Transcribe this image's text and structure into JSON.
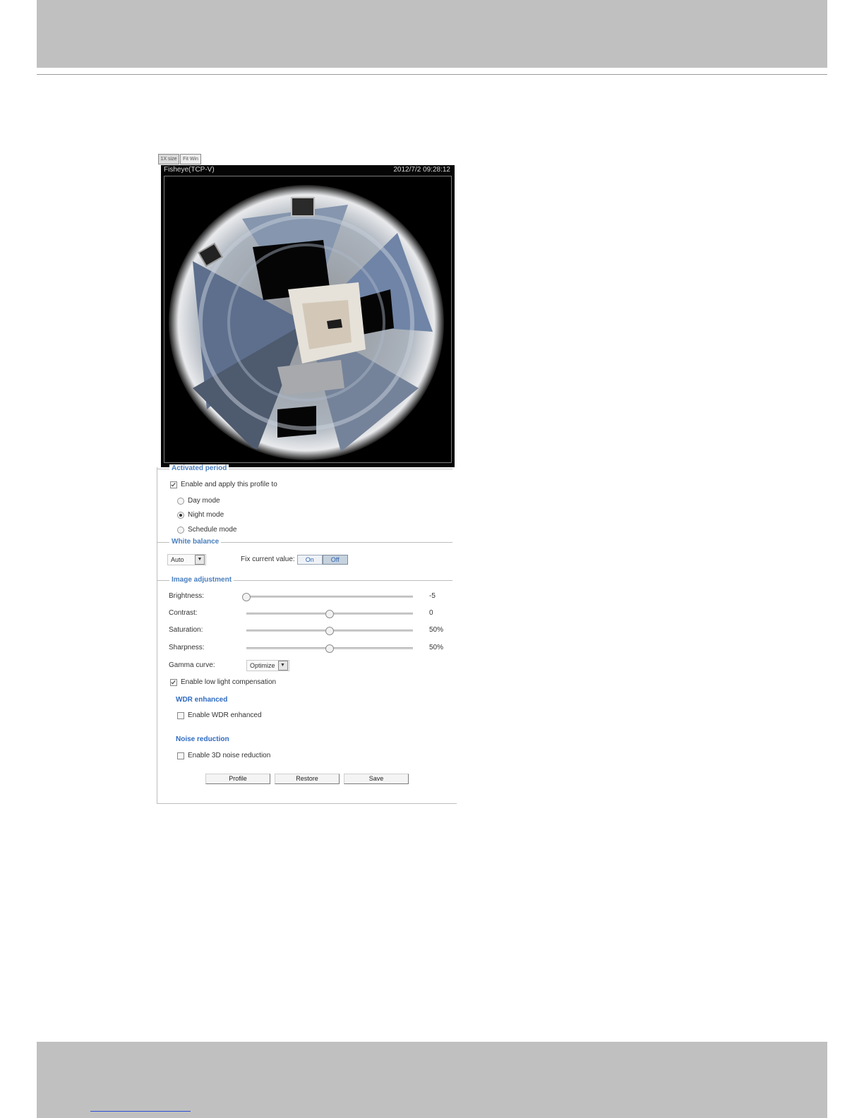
{
  "view_tabs": [
    "1X size",
    "Fit Win"
  ],
  "video": {
    "title": "Fisheye(TCP-V)",
    "timestamp": "2012/7/2 09:28:12"
  },
  "activated_period": {
    "legend": "Activated period",
    "enable_label": "Enable and apply this profile to",
    "enable_checked": true,
    "modes": [
      {
        "label": "Day mode",
        "selected": false
      },
      {
        "label": "Night mode",
        "selected": true
      },
      {
        "label": "Schedule mode",
        "selected": false
      }
    ]
  },
  "white_balance": {
    "legend": "White balance",
    "mode_value": "Auto",
    "fix_label": "Fix current value:",
    "on_label": "On",
    "off_label": "Off",
    "active": "Off"
  },
  "image_adjustment": {
    "legend": "Image adjustment",
    "sliders": [
      {
        "label": "Brightness:",
        "value": "-5",
        "fraction": 0.0
      },
      {
        "label": "Contrast:",
        "value": "0",
        "fraction": 0.5
      },
      {
        "label": "Saturation:",
        "value": "50%",
        "fraction": 0.5
      },
      {
        "label": "Sharpness:",
        "value": "50%",
        "fraction": 0.5
      }
    ],
    "gamma_label": "Gamma curve:",
    "gamma_value": "Optimize",
    "low_light_label": "Enable low light compensation",
    "low_light_checked": true
  },
  "wdr": {
    "heading": "WDR enhanced",
    "enable_label": "Enable WDR enhanced",
    "checked": false
  },
  "noise": {
    "heading": "Noise reduction",
    "enable_label": "Enable 3D noise reduction",
    "checked": false
  },
  "buttons": {
    "profile": "Profile",
    "restore": "Restore",
    "save": "Save"
  },
  "colors": {
    "header_band": "#c0c0c0",
    "accent_blue": "#4a7fbf",
    "link_blue": "#2c4fd6"
  }
}
